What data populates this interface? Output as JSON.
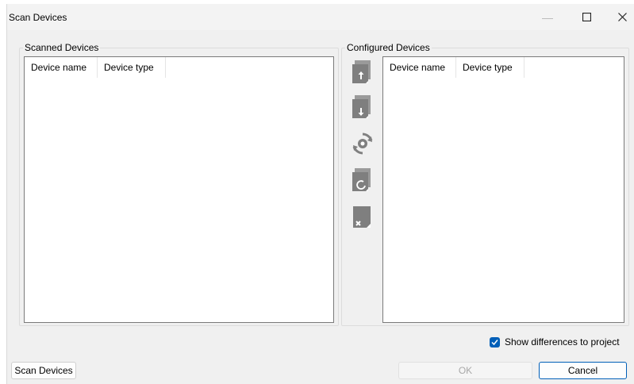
{
  "window": {
    "title": "Scan Devices",
    "minimize_icon": "minimize-icon",
    "maximize_icon": "maximize-icon",
    "close_icon": "close-icon"
  },
  "scanned": {
    "group_label": "Scanned Devices",
    "columns": [
      "Device name",
      "Device type"
    ],
    "rows": []
  },
  "configured": {
    "group_label": "Configured Devices",
    "columns": [
      "Device name",
      "Device type"
    ],
    "rows": []
  },
  "toolbar": {
    "buttons": [
      {
        "icon": "upload-device-icon"
      },
      {
        "icon": "download-device-icon"
      },
      {
        "icon": "sync-settings-icon"
      },
      {
        "icon": "refresh-device-icon"
      },
      {
        "icon": "delete-device-icon"
      }
    ]
  },
  "options": {
    "show_differences_label": "Show differences to project",
    "show_differences_checked": true
  },
  "footer": {
    "scan_label": "Scan Devices",
    "ok_label": "OK",
    "cancel_label": "Cancel"
  },
  "colors": {
    "accent": "#005fb8",
    "icon_gray": "#8a8a8a",
    "window_bg": "#f0f0f0"
  }
}
